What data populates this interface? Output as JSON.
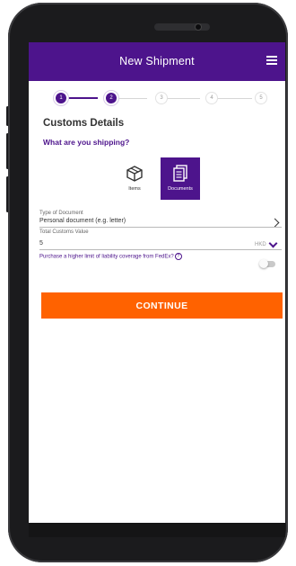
{
  "header": {
    "title": "New Shipment",
    "menu_icon": "hamburger-menu-icon"
  },
  "stepper": {
    "steps": [
      "1",
      "2",
      "3",
      "4",
      "5"
    ],
    "current_step": 2,
    "active_color": "#4d148c"
  },
  "section": {
    "title": "Customs Details",
    "question": "What are you shipping?"
  },
  "shipment_types": [
    {
      "label": "Items",
      "icon": "box-icon",
      "selected": false
    },
    {
      "label": "Documents",
      "icon": "documents-icon",
      "selected": true
    }
  ],
  "fields": {
    "document_type": {
      "label": "Type of Document",
      "value": "Personal document (e.g. letter)"
    },
    "customs_value": {
      "label": "Total Customs Value",
      "value": "5",
      "currency": "HKD"
    }
  },
  "liability": {
    "text": "Purchase a higher limit of liability coverage from FedEx?",
    "info_glyph": "?",
    "enabled": false
  },
  "continue_button": {
    "label": "CONTINUE",
    "color": "#ff6200"
  },
  "colors": {
    "brand_purple": "#4d148c",
    "brand_orange": "#ff6200"
  }
}
